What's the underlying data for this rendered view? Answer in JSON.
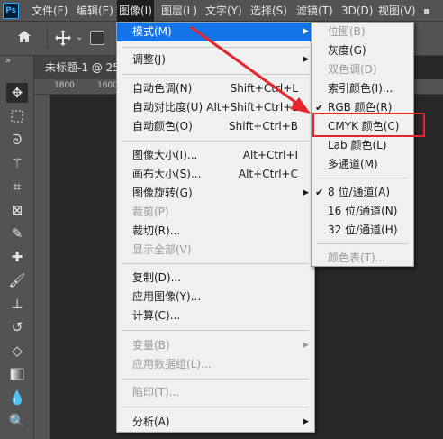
{
  "menubar": {
    "logo": "Ps",
    "items": [
      "文件(F)",
      "编辑(E)",
      "图像(I)",
      "图层(L)",
      "文字(Y)",
      "选择(S)",
      "滤镜(T)",
      "3D(D)",
      "视图(V)"
    ]
  },
  "document": {
    "tab_title": "未标题-1 @ 25",
    "ruler_ticks": [
      "1800",
      "1600"
    ]
  },
  "image_menu": {
    "items": [
      {
        "label": "模式(M)",
        "shortcut": "",
        "submenu": true,
        "disabled": false,
        "highlighted": true
      },
      {
        "label": "调整(J)",
        "shortcut": "",
        "submenu": true,
        "disabled": false
      },
      {
        "label": "自动色调(N)",
        "shortcut": "Shift+Ctrl+L",
        "submenu": false,
        "disabled": false
      },
      {
        "label": "自动对比度(U)",
        "shortcut": "Alt+Shift+Ctrl+L",
        "submenu": false,
        "disabled": false
      },
      {
        "label": "自动颜色(O)",
        "shortcut": "Shift+Ctrl+B",
        "submenu": false,
        "disabled": false
      },
      {
        "label": "图像大小(I)...",
        "shortcut": "Alt+Ctrl+I",
        "submenu": false,
        "disabled": false
      },
      {
        "label": "画布大小(S)...",
        "shortcut": "Alt+Ctrl+C",
        "submenu": false,
        "disabled": false
      },
      {
        "label": "图像旋转(G)",
        "shortcut": "",
        "submenu": true,
        "disabled": false
      },
      {
        "label": "裁剪(P)",
        "shortcut": "",
        "submenu": false,
        "disabled": true
      },
      {
        "label": "裁切(R)...",
        "shortcut": "",
        "submenu": false,
        "disabled": false
      },
      {
        "label": "显示全部(V)",
        "shortcut": "",
        "submenu": false,
        "disabled": true
      },
      {
        "label": "复制(D)...",
        "shortcut": "",
        "submenu": false,
        "disabled": false
      },
      {
        "label": "应用图像(Y)...",
        "shortcut": "",
        "submenu": false,
        "disabled": false
      },
      {
        "label": "计算(C)...",
        "shortcut": "",
        "submenu": false,
        "disabled": false
      },
      {
        "label": "变量(B)",
        "shortcut": "",
        "submenu": true,
        "disabled": true
      },
      {
        "label": "应用数据组(L)...",
        "shortcut": "",
        "submenu": false,
        "disabled": true
      },
      {
        "label": "陷印(T)...",
        "shortcut": "",
        "submenu": false,
        "disabled": true
      },
      {
        "label": "分析(A)",
        "shortcut": "",
        "submenu": true,
        "disabled": false
      }
    ]
  },
  "mode_menu": {
    "items": [
      {
        "label": "位图(B)",
        "checked": false,
        "disabled": true
      },
      {
        "label": "灰度(G)",
        "checked": false,
        "disabled": false
      },
      {
        "label": "双色调(D)",
        "checked": false,
        "disabled": true
      },
      {
        "label": "索引颜色(I)...",
        "checked": false,
        "disabled": false
      },
      {
        "label": "RGB 颜色(R)",
        "checked": true,
        "disabled": false
      },
      {
        "label": "CMYK 颜色(C)",
        "checked": false,
        "disabled": false
      },
      {
        "label": "Lab 颜色(L)",
        "checked": false,
        "disabled": false
      },
      {
        "label": "多通道(M)",
        "checked": false,
        "disabled": false
      },
      {
        "label": "8 位/通道(A)",
        "checked": true,
        "disabled": false
      },
      {
        "label": "16 位/通道(N)",
        "checked": false,
        "disabled": false
      },
      {
        "label": "32 位/通道(H)",
        "checked": false,
        "disabled": false
      },
      {
        "label": "颜色表(T)...",
        "checked": false,
        "disabled": true
      }
    ]
  },
  "colors": {
    "highlight": "#1473e6",
    "annotation": "#e5272d"
  }
}
